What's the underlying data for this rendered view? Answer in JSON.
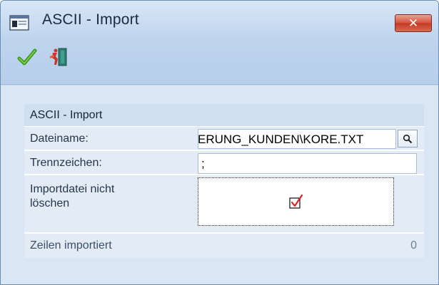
{
  "window": {
    "title": "ASCII - Import",
    "close_label": "✕"
  },
  "toolbar": {
    "ok_icon": "green-checkmark-icon",
    "exit_icon": "exit-door-icon"
  },
  "form": {
    "group_title": "ASCII - Import",
    "filename": {
      "label": "Dateiname:",
      "value": "ERUNG_KUNDEN\\KORE.TXT"
    },
    "separator": {
      "label": "Trennzeichen:",
      "value": ";"
    },
    "keep_file": {
      "label_line1": "Importdatei nicht",
      "label_line2": "löschen",
      "checked": true
    },
    "lines_imported": {
      "label": "Zeilen importiert",
      "value": "0"
    }
  },
  "colors": {
    "frame": "#6d8cb4",
    "close_button": "#d6543f",
    "row_background": "#e3ecf6",
    "check_mark": "#e02020"
  }
}
